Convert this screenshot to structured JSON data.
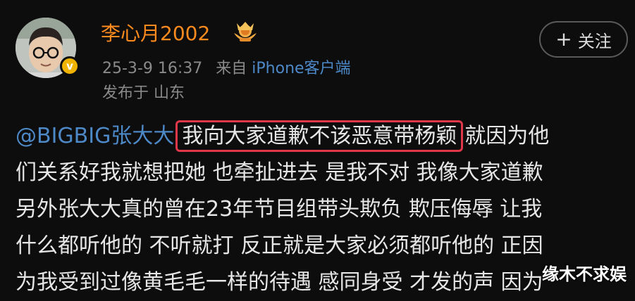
{
  "post": {
    "username": "李心月2002",
    "timestamp": "25-3-9 16:37",
    "source_prefix": "来自",
    "source": "iPhone客户端",
    "location": "发布于 山东",
    "follow_button": "关注",
    "follow_icon": "plus-icon",
    "verified_badge": "v",
    "username_color": "#ff8a1e",
    "link_color": "#4d88c7",
    "highlight_color": "#e0384a"
  },
  "content": {
    "mention": "@BIGBIG张大大",
    "highlighted": "我向大家道歉不该恶意带杨颖",
    "line1_rest": "就因为他",
    "line2": "们关系好我就想把她 也牵扯进去 是我不对 我像大家道歉",
    "line3": "另外张大大真的曾在23年节目组带头欺负 欺压侮辱 让我",
    "line4": "什么都听他的 不听就打 反正就是大家必须都听他的 正因",
    "line5": "为我受到过像黄毛毛一样的待遇 感同身受 才发的声 因为"
  },
  "watermark": "缘木不求娱"
}
